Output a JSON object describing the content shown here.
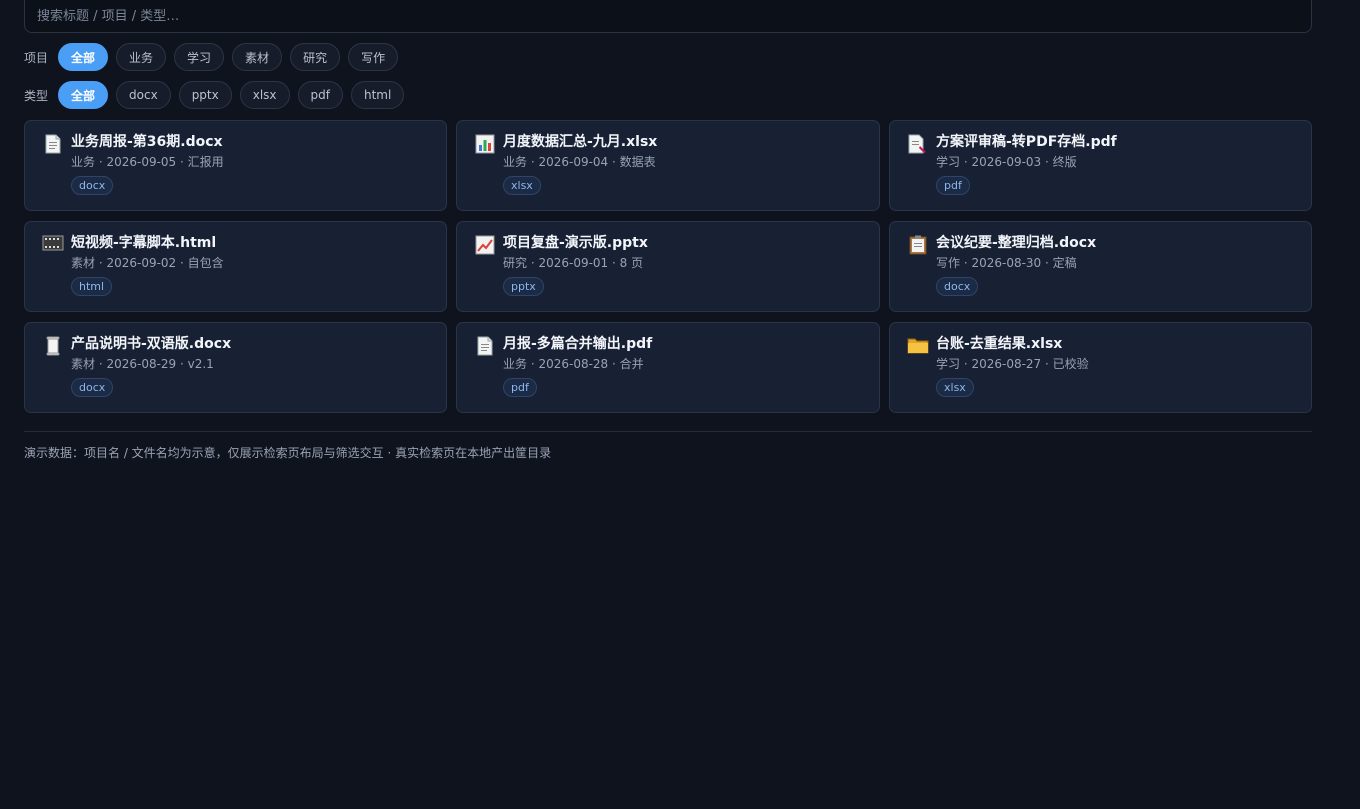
{
  "search": {
    "placeholder": "搜索标题 / 项目 / 类型…"
  },
  "filters": {
    "project": {
      "label": "项目",
      "chips": [
        "全部",
        "业务",
        "学习",
        "素材",
        "研究",
        "写作"
      ]
    },
    "type": {
      "label": "类型",
      "chips": [
        "全部",
        "docx",
        "pptx",
        "xlsx",
        "pdf",
        "html"
      ]
    }
  },
  "cards": [
    {
      "icon": "document-icon",
      "title": "业务周报-第36期.docx",
      "meta": "业务 · 2026-09-05 · 汇报用",
      "tag": "docx"
    },
    {
      "icon": "bar-chart-icon",
      "title": "月度数据汇总-九月.xlsx",
      "meta": "业务 · 2026-09-04 · 数据表",
      "tag": "xlsx"
    },
    {
      "icon": "document-edit-icon",
      "title": "方案评审稿-转PDF存档.pdf",
      "meta": "学习 · 2026-09-03 · 终版",
      "tag": "pdf"
    },
    {
      "icon": "film-icon",
      "title": "短视频-字幕脚本.html",
      "meta": "素材 · 2026-09-02 · 自包含",
      "tag": "html"
    },
    {
      "icon": "trend-chart-icon",
      "title": "项目复盘-演示版.pptx",
      "meta": "研究 · 2026-09-01 · 8 页",
      "tag": "pptx"
    },
    {
      "icon": "clipboard-icon",
      "title": "会议纪要-整理归档.docx",
      "meta": "写作 · 2026-08-30 · 定稿",
      "tag": "docx"
    },
    {
      "icon": "scroll-icon",
      "title": "产品说明书-双语版.docx",
      "meta": "素材 · 2026-08-29 · v2.1",
      "tag": "docx"
    },
    {
      "icon": "document-icon",
      "title": "月报-多篇合并输出.pdf",
      "meta": "业务 · 2026-08-28 · 合并",
      "tag": "pdf"
    },
    {
      "icon": "folder-icon",
      "title": "台账-去重结果.xlsx",
      "meta": "学习 · 2026-08-27 · 已校验",
      "tag": "xlsx"
    }
  ],
  "footnote": "演示数据：项目名 / 文件名均为示意，仅展示检索页布局与筛选交互 · 真实检索页在本地产出筐目录",
  "colors": {
    "accent": "#4a9ef5",
    "background": "#0f131e",
    "card": "#182033"
  }
}
